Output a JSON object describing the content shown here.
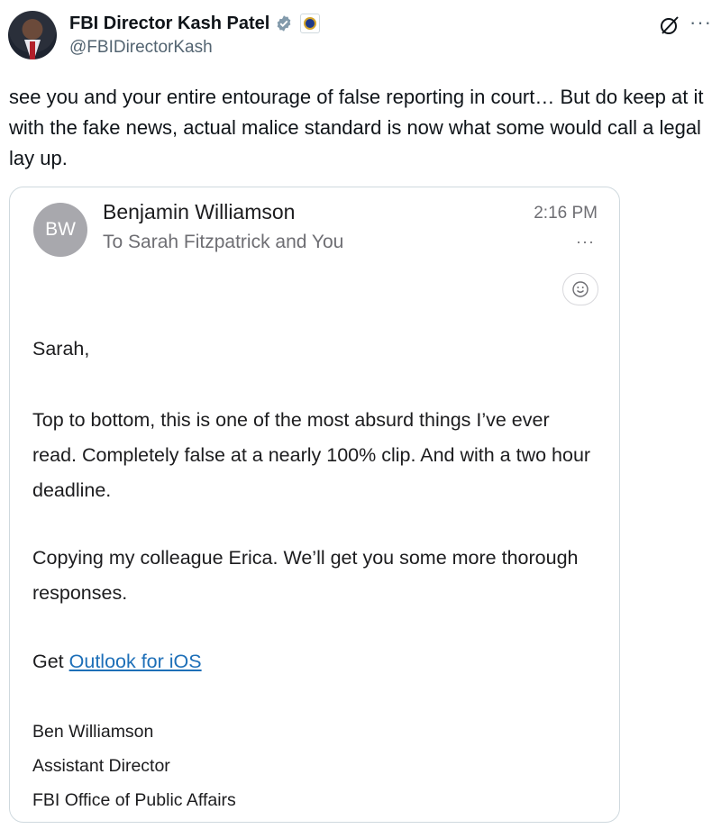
{
  "post": {
    "display_name": "FBI Director Kash Patel",
    "handle": "@FBIDirectorKash",
    "text": "see you and your entire entourage of false reporting in court… But do keep at it with the fake news, actual malice standard is now what some would call a legal lay up.",
    "more_label": "···",
    "icons": [
      "avatar",
      "verified-badge-icon",
      "fbi-seal-icon",
      "grok-icon",
      "more-icon"
    ]
  },
  "email": {
    "avatar_initials": "BW",
    "sender": "Benjamin Williamson",
    "recipients": "To Sarah Fitzpatrick and You",
    "time": "2:16 PM",
    "more_label": "···",
    "emoji_icon": "☺",
    "greeting": "Sarah,",
    "paragraph1": "Top to bottom, this is one of the most absurd things I’ve ever read. Completely false at a nearly 100% clip. And with a two hour deadline.",
    "paragraph2": "Copying my colleague Erica. We’ll get you some more thorough responses.",
    "get_prefix": "Get ",
    "link_text": "Outlook for iOS",
    "signature": {
      "name": "Ben Williamson",
      "title": "Assistant Director",
      "office": "FBI Office of Public Affairs"
    }
  },
  "colors": {
    "link": "#1d6fb8",
    "verified": "#829aab",
    "secondary_text": "#536471"
  }
}
